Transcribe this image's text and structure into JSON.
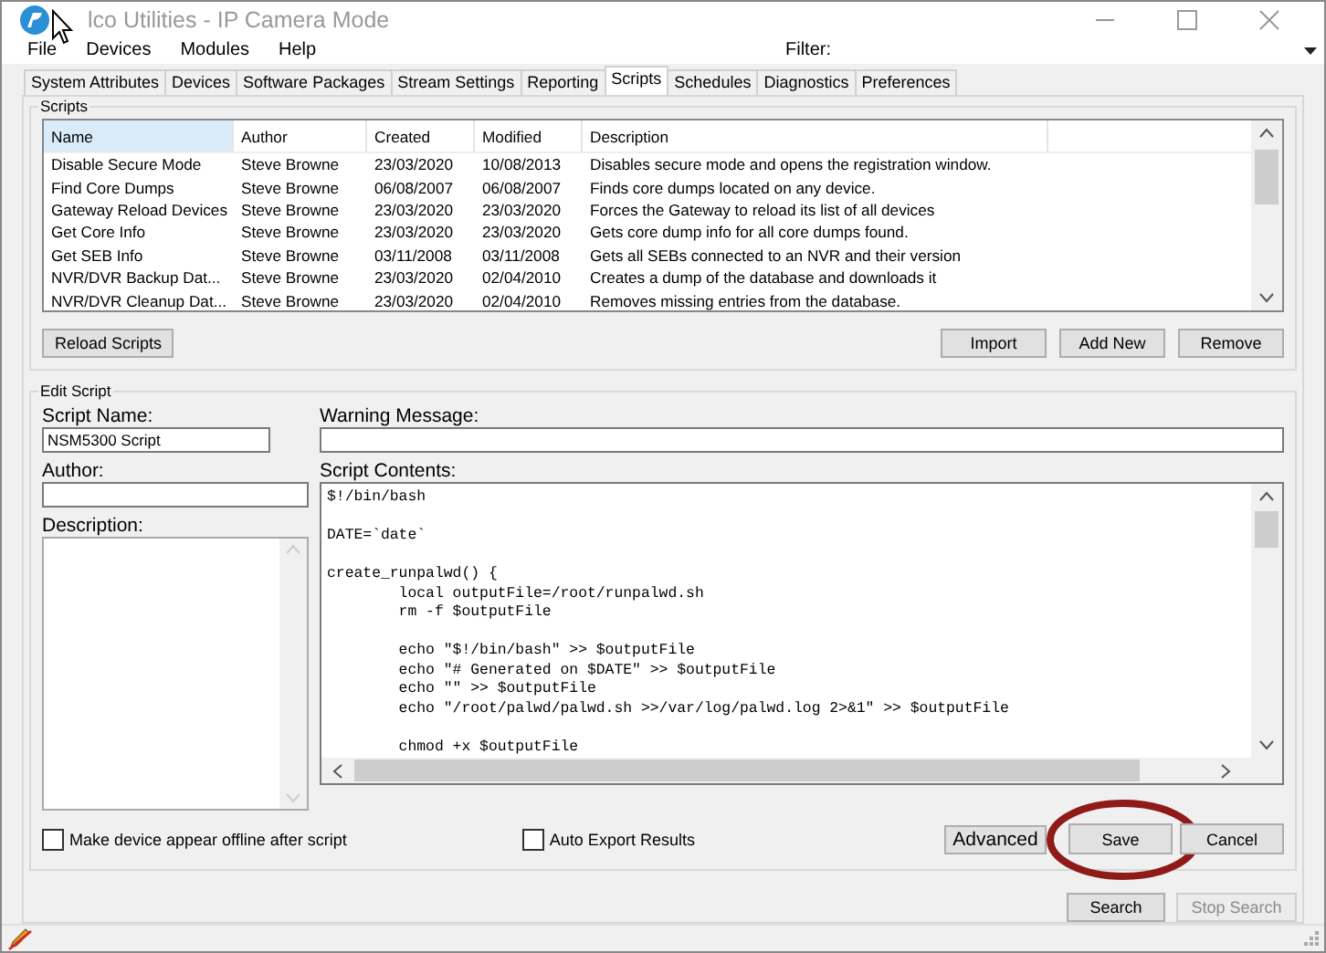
{
  "window": {
    "title": "lco Utilities - IP Camera Mode"
  },
  "menu": [
    "File",
    "Devices",
    "Modules",
    "Help"
  ],
  "filter": {
    "label": "Filter:"
  },
  "tabs": [
    {
      "label": "System Attributes",
      "selected": false
    },
    {
      "label": "Devices",
      "selected": false
    },
    {
      "label": "Software Packages",
      "selected": false
    },
    {
      "label": "Stream Settings",
      "selected": false
    },
    {
      "label": "Reporting",
      "selected": false
    },
    {
      "label": "Scripts",
      "selected": true
    },
    {
      "label": "Schedules",
      "selected": false
    },
    {
      "label": "Diagnostics",
      "selected": false
    },
    {
      "label": "Preferences",
      "selected": false
    }
  ],
  "scripts": {
    "title": "Scripts",
    "columns": [
      {
        "label": "Name",
        "highlighted": true
      },
      {
        "label": "Author",
        "highlighted": false
      },
      {
        "label": "Created",
        "highlighted": false
      },
      {
        "label": "Modified",
        "highlighted": false
      },
      {
        "label": "Description",
        "highlighted": false
      }
    ],
    "rows": [
      [
        "Disable Secure Mode",
        "Steve Browne",
        "23/03/2020",
        "10/08/2013",
        "Disables secure mode and opens the registration window."
      ],
      [
        "Find Core Dumps",
        "Steve Browne",
        "06/08/2007",
        "06/08/2007",
        "Finds core dumps located on any device."
      ],
      [
        "Gateway Reload Devices",
        "Steve Browne",
        "23/03/2020",
        "23/03/2020",
        "Forces the Gateway to reload its list of all devices"
      ],
      [
        "Get Core Info",
        "Steve Browne",
        "23/03/2020",
        "23/03/2020",
        "Gets core dump info for all core dumps found."
      ],
      [
        "Get SEB Info",
        "Steve Browne",
        "03/11/2008",
        "03/11/2008",
        "Gets all SEBs connected to an NVR and their version"
      ],
      [
        "NVR/DVR Backup Dat...",
        "Steve Browne",
        "23/03/2020",
        "02/04/2010",
        "Creates a dump of the database and downloads it"
      ],
      [
        "NVR/DVR Cleanup Dat...",
        "Steve Browne",
        "23/03/2020",
        "02/04/2010",
        "Removes missing entries from the database."
      ]
    ],
    "left_buttons": [
      "Reload Scripts"
    ],
    "right_buttons": [
      "Import",
      "Add New",
      "Remove"
    ]
  },
  "edit": {
    "title": "Edit Script",
    "script_name": {
      "label": "Script Name:",
      "value": "NSM5300 Script"
    },
    "author": {
      "label": "Author:"
    },
    "description": {
      "label": "Description:"
    },
    "warning": {
      "label": "Warning Message:"
    },
    "contents": {
      "label": "Script Contents:",
      "lines": [
        {
          "text": "$!/bin/bash",
          "gap_before": false
        },
        {
          "text": "DATE=`date`",
          "gap_before": true
        },
        {
          "text": "create_runpalwd() {",
          "gap_before": true
        },
        {
          "text": "        local outputFile=/root/runpalwd.sh",
          "gap_before": false
        },
        {
          "text": "        rm -f $outputFile",
          "gap_before": false
        },
        {
          "text": "        echo \"$!/bin/bash\" >> $outputFile",
          "gap_before": true
        },
        {
          "text": "        echo \"# Generated on $DATE\" >> $outputFile",
          "gap_before": false
        },
        {
          "text": "        echo \"\" >> $outputFile",
          "gap_before": false
        },
        {
          "text": "        echo \"/root/palwd/palwd.sh >>/var/log/palwd.log 2>&1\" >> $outputFile",
          "gap_before": false
        },
        {
          "text": "        chmod +x $outputFile",
          "gap_before": true
        }
      ]
    },
    "checkboxes": [
      {
        "label": "Make device appear offline after script",
        "checked": false
      },
      {
        "label": "Auto Export Results",
        "checked": false
      }
    ],
    "buttons": [
      {
        "label": "Advanced",
        "kind": "large",
        "circled": false
      },
      {
        "label": "Save",
        "kind": "normal",
        "circled": true
      },
      {
        "label": "Cancel",
        "kind": "normal",
        "circled": false
      }
    ]
  },
  "bottom_buttons": [
    {
      "label": "Search",
      "disabled": false
    },
    {
      "label": "Stop Search",
      "disabled": true
    }
  ]
}
